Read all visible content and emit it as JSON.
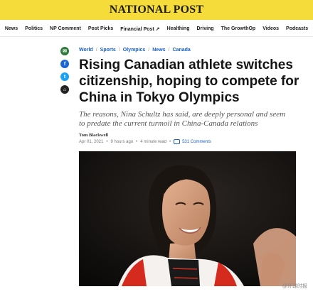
{
  "site": {
    "logo": "NATIONAL POST",
    "nav": [
      "News",
      "Politics",
      "NP Comment",
      "Post Picks",
      "Financial Post",
      "Healthing",
      "Driving",
      "The GrowthOp",
      "Videos",
      "Podcasts"
    ],
    "external_link_glyph": "↗"
  },
  "share": {
    "icons": [
      "email-icon",
      "facebook-icon",
      "twitter-icon",
      "bookmark-icon"
    ],
    "glyphs": {
      "email": "✉",
      "facebook": "f",
      "twitter": "t",
      "bookmark": "⌂"
    }
  },
  "article": {
    "breadcrumb": [
      "World",
      "Sports",
      "Olympics",
      "News",
      "Canada"
    ],
    "headline": "Rising Canadian athlete switches citizenship, hoping to compete for China in Tokyo Olympics",
    "dek": "The reasons, Nina Schultz has said, are deeply personal and seem to predate the current turmoil in China-Canada relations",
    "author": "Tom Blackwell",
    "date": "Apr 01, 2021",
    "time_ago": "9 hours ago",
    "read_time": "4 minute read",
    "comments": "531 Comments"
  },
  "watermark": "@环球时报",
  "colors": {
    "masthead": "#f6dc3a",
    "link": "#1a5fc7",
    "text": "#141414"
  }
}
